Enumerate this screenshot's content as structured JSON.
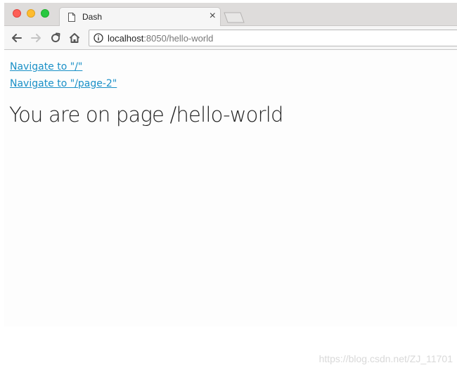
{
  "window": {
    "traffic_colors": {
      "close": "#fd5f57",
      "minimize": "#febc2e",
      "zoom": "#28c840"
    }
  },
  "tab": {
    "title": "Dash",
    "close_label": "×",
    "icon": "document-icon"
  },
  "toolbar": {
    "back_icon": "arrow-left-icon",
    "forward_icon": "arrow-right-icon",
    "reload_icon": "reload-icon",
    "home_icon": "home-icon",
    "info_icon": "info-icon"
  },
  "address": {
    "host": "localhost",
    "rest": ":8050/hello-world"
  },
  "page": {
    "links": [
      {
        "label": "Navigate to \"/\""
      },
      {
        "label": "Navigate to \"/page-2\""
      }
    ],
    "heading": "You are on page /hello-world",
    "link_color": "#1a90c7"
  },
  "watermark": "https://blog.csdn.net/ZJ_11701"
}
